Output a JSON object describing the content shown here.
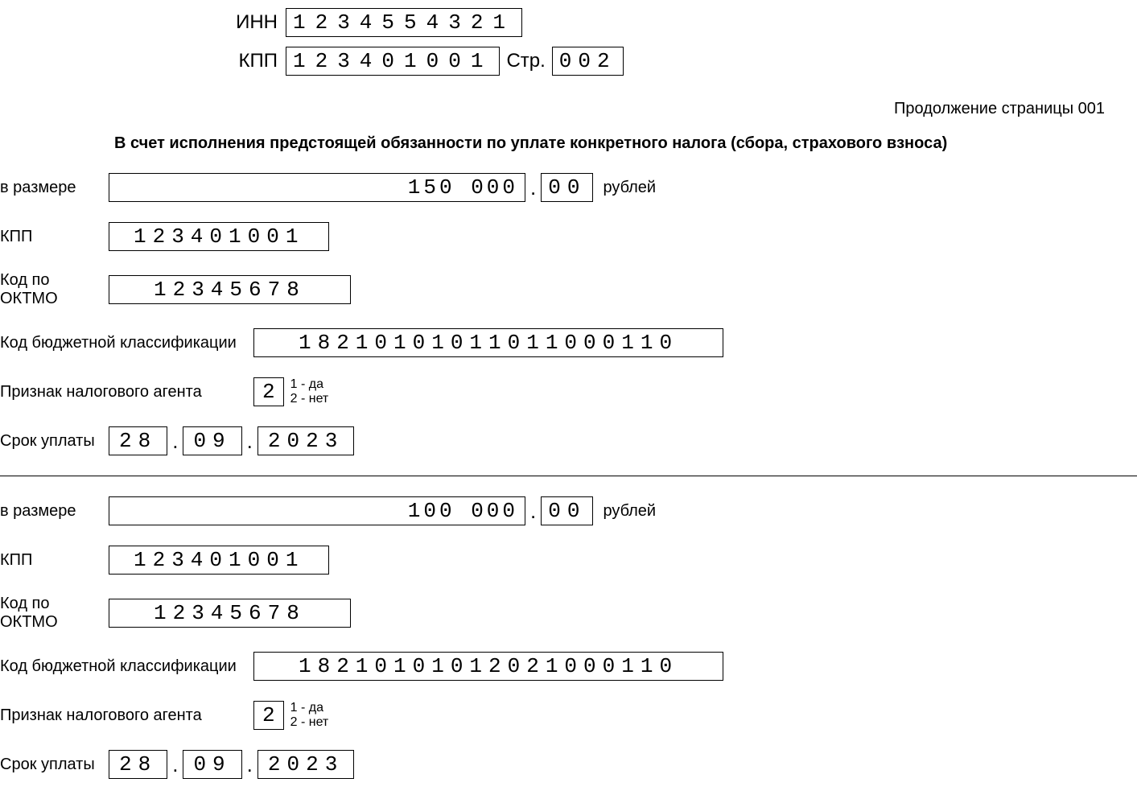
{
  "header": {
    "inn_label": "ИНН",
    "inn_value": "1234554321",
    "kpp_label": "КПП",
    "kpp_value": "123401001",
    "page_label": "Стр.",
    "page_value": "002"
  },
  "continuation": "Продолжение страницы 001",
  "section_title": "В счет исполнения предстоящей обязанности по уплате конкретного налога (сбора, страхового взноса)",
  "labels": {
    "amount": "в размере",
    "rubles": "рублей",
    "kpp": "КПП",
    "oktmo": "Код по ОКТМО",
    "kbk": "Код бюджетной классификации",
    "agent": "Признак налогового агента",
    "agent_1": "1 - да",
    "agent_2": "2 - нет",
    "due_date": "Срок уплаты",
    "dot": "."
  },
  "blocks": [
    {
      "amount_rub": "150 000",
      "amount_kop": "00",
      "kpp": "123401001",
      "oktmo": "12345678",
      "kbk": "18210101011011000110",
      "agent": "2",
      "date_day": "28",
      "date_month": "09",
      "date_year": "2023"
    },
    {
      "amount_rub": "100 000",
      "amount_kop": "00",
      "kpp": "123401001",
      "oktmo": "12345678",
      "kbk": "18210101012021000110",
      "agent": "2",
      "date_day": "28",
      "date_month": "09",
      "date_year": "2023"
    }
  ]
}
